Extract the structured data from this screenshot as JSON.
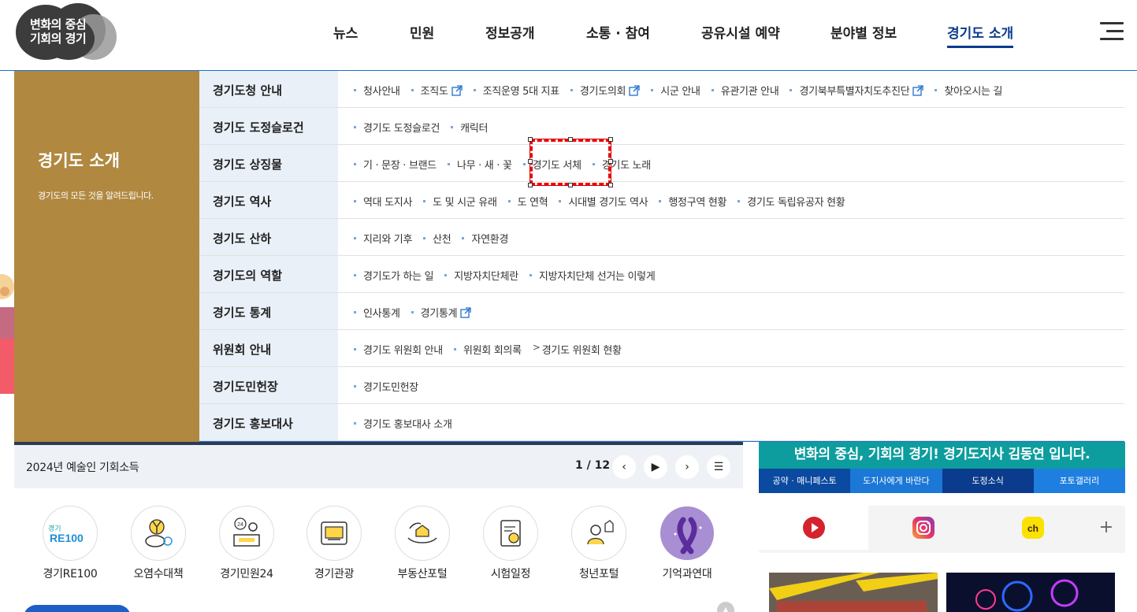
{
  "header": {
    "logo_line1": "변화의 중심",
    "logo_line2": "기회의 경기",
    "nav": [
      "뉴스",
      "민원",
      "정보공개",
      "소통 · 참여",
      "공유시설 예약",
      "분야별 정보",
      "경기도 소개"
    ],
    "active_nav": "경기도 소개",
    "menu_icon": "hamburger-icon"
  },
  "mega_menu": {
    "title": "경기도 소개",
    "description": "경기도의 모든 것을 알려드립니다.",
    "rows": [
      {
        "category": "경기도청 안내",
        "links": [
          {
            "label": "청사안내"
          },
          {
            "label": "조직도",
            "external": true
          },
          {
            "label": "조직운영 5대 지표"
          },
          {
            "label": "경기도의회",
            "external": true
          },
          {
            "label": "시군 안내"
          },
          {
            "label": "유관기관 안내"
          },
          {
            "label": "경기북부특별자치도추진단",
            "external": true
          },
          {
            "label": "찾아오시는 길"
          }
        ]
      },
      {
        "category": "경기도 도정슬로건",
        "links": [
          {
            "label": "경기도 도정슬로건"
          },
          {
            "label": "캐릭터"
          }
        ]
      },
      {
        "category": "경기도 상징물",
        "links": [
          {
            "label": "기 · 문장 · 브랜드"
          },
          {
            "label": "나무 · 새 · 꽃"
          },
          {
            "label": "경기도 서체"
          },
          {
            "label": "경기도 노래"
          }
        ]
      },
      {
        "category": "경기도 역사",
        "links": [
          {
            "label": "역대 도지사"
          },
          {
            "label": "도 및 시군 유래"
          },
          {
            "label": "도 연혁"
          },
          {
            "label": "시대별 경기도 역사"
          },
          {
            "label": "행정구역 현황"
          },
          {
            "label": "경기도 독립유공자 현황"
          }
        ]
      },
      {
        "category": "경기도 산하",
        "links": [
          {
            "label": "지리와 기후"
          },
          {
            "label": "산천"
          },
          {
            "label": "자연환경"
          }
        ]
      },
      {
        "category": "경기도의 역할",
        "links": [
          {
            "label": "경기도가 하는 일"
          },
          {
            "label": "지방자치단체란"
          },
          {
            "label": "지방자치단체 선거는 이렇게"
          }
        ]
      },
      {
        "category": "경기도 통계",
        "links": [
          {
            "label": "인사통계"
          },
          {
            "label": "경기통계",
            "external": true
          }
        ]
      },
      {
        "category": "위원회 안내",
        "links": [
          {
            "label": "경기도 위원회 안내"
          },
          {
            "label": "위원회 회의록"
          },
          {
            "label": "경기도 위원회 현황",
            "sub": true
          }
        ]
      },
      {
        "category": "경기도민헌장",
        "links": [
          {
            "label": "경기도민헌장"
          }
        ]
      },
      {
        "category": "경기도 홍보대사",
        "links": [
          {
            "label": "경기도 홍보대사 소개"
          }
        ]
      }
    ]
  },
  "slider": {
    "title": "2024년 예술인 기회소득",
    "pager": "1 / 12"
  },
  "quick_links": [
    {
      "label": "경기RE100",
      "icon": "re100-logo-icon"
    },
    {
      "label": "오염수대책",
      "icon": "radiation-fish-icon"
    },
    {
      "label": "경기민원24",
      "icon": "civil-service-24-icon"
    },
    {
      "label": "경기관광",
      "icon": "tour-map-icon"
    },
    {
      "label": "부동산포털",
      "icon": "real-estate-hands-icon"
    },
    {
      "label": "시험일정",
      "icon": "exam-document-icon"
    },
    {
      "label": "청년포털",
      "icon": "youth-portal-icon"
    },
    {
      "label": "기억과연대",
      "icon": "purple-ribbon-icon"
    }
  ],
  "governor_banner": {
    "headline": "변화의 중심, 기회의 경기! 경기도지사 김동연 입니다.",
    "tabs": [
      "공약 · 매니페스토",
      "도지사에게 바란다",
      "도정소식",
      "포토갤러리"
    ],
    "tab_colors": [
      "#0a4aa0",
      "#1b78d6",
      "#0a3b8c",
      "#1e7fe0"
    ]
  },
  "social": [
    "youtube-icon",
    "instagram-icon",
    "kakao-channel-icon"
  ],
  "colors": {
    "accent": "#0a3b8c",
    "mega_left": "#b08840",
    "row_bg": "#e9f0f7",
    "banner_top": "#0d9d9e"
  }
}
